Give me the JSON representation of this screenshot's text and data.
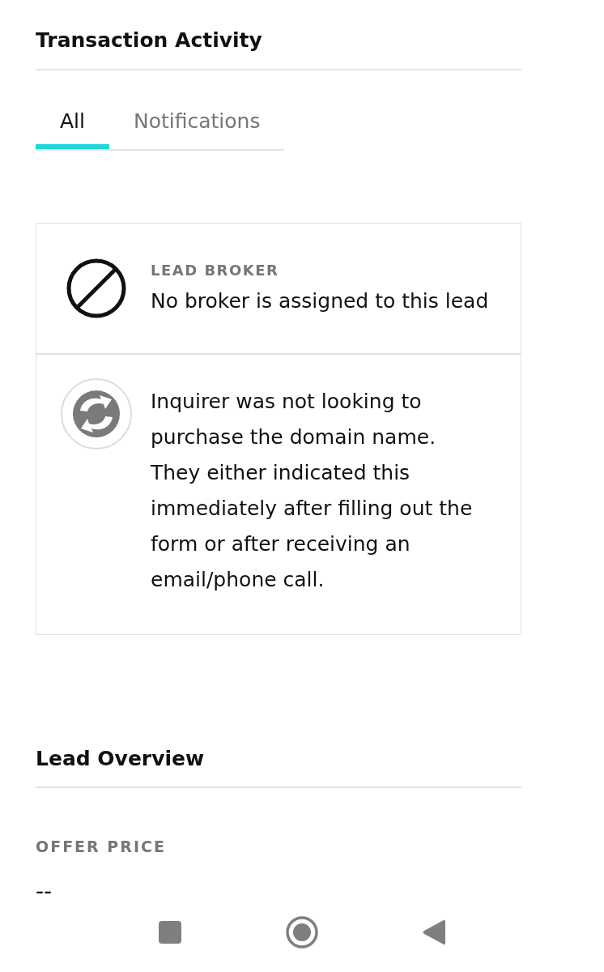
{
  "activity_section": {
    "title": "Transaction Activity"
  },
  "tabs": [
    {
      "label": "All",
      "selected": true
    },
    {
      "label": "Notifications",
      "selected": false
    }
  ],
  "activity": [
    {
      "kind": "broker",
      "label": "LEAD BROKER",
      "text": "No broker is assigned to this lead"
    },
    {
      "kind": "status",
      "text": "Inquirer was not looking to purchase the domain name. They either indicated this immediately after filling out the form or after receiving an email/phone call."
    }
  ],
  "overview": {
    "title": "Lead Overview",
    "fields": [
      {
        "label": "OFFER PRICE",
        "value": "--"
      }
    ]
  }
}
